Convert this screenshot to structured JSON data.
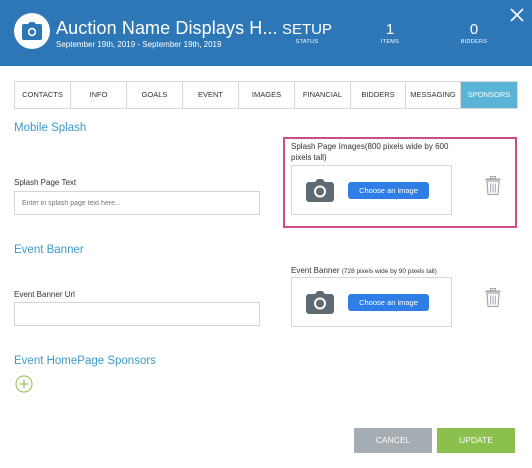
{
  "header": {
    "title": "Auction Name Displays H...",
    "dates": "September 19th, 2019 - September 19th, 2019",
    "stats": {
      "status": {
        "value": "SETUP",
        "label": "STATUS"
      },
      "items": {
        "value": "1",
        "label": "ITEMS"
      },
      "bidders": {
        "value": "0",
        "label": "BIDDERS"
      }
    },
    "camera_icon": "camera-icon",
    "close_icon": "close-icon"
  },
  "tabs": [
    "CONTACTS",
    "INFO",
    "GOALS",
    "EVENT",
    "IMAGES",
    "FINANCIAL",
    "BIDDERS",
    "MESSAGING",
    "SPONSORS"
  ],
  "active_tab": "SPONSORS",
  "mobile_splash": {
    "title": "Mobile Splash",
    "text_label": "Splash Page Text",
    "text_placeholder": "Enter in splash page text here...",
    "images_label": "Splash Page Images(800 pixels wide by 600 pixels tall)",
    "choose_label": "Choose an image"
  },
  "event_banner": {
    "title": "Event Banner",
    "url_label": "Event Banner Url",
    "url_value": "",
    "image_label": "Event Banner",
    "image_note": "(728 pixels wide by 90 pixels tall)",
    "choose_label": "Choose an image"
  },
  "sponsors": {
    "title": "Event HomePage Sponsors",
    "add_icon": "plus-circle-icon"
  },
  "footer": {
    "cancel_label": "CANCEL",
    "update_label": "UPDATE"
  },
  "colors": {
    "header_bg": "#2e77b6",
    "accent": "#3e9ac9",
    "active_tab": "#5ab4d8",
    "choose_button": "#2f7ee6",
    "highlight": "#cf4c8a",
    "cancel": "#a5adb3",
    "update": "#8cc04d"
  }
}
